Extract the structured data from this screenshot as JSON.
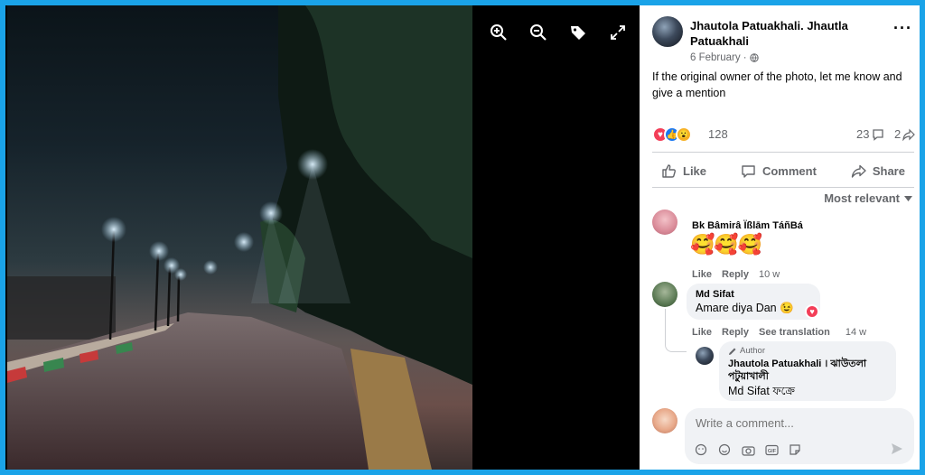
{
  "viewer": {
    "tools": [
      "zoom-in-icon",
      "zoom-out-icon",
      "tag-icon",
      "fullscreen-icon"
    ]
  },
  "post": {
    "page_name": "Jhautola Patuakhali. Jhautla Patuakhali",
    "date": "6 February ·",
    "privacy_icon": "globe-icon",
    "caption": "If the original owner of the photo, let me know and give a mention",
    "reaction_count": "128",
    "comment_count": "23",
    "share_count": "2"
  },
  "actions": {
    "like": "Like",
    "comment": "Comment",
    "share": "Share"
  },
  "sort": {
    "label": "Most relevant"
  },
  "comments": [
    {
      "name": "Bk Bâmirâ Ïßlām TáñBá",
      "text": "🥰🥰🥰",
      "like": "Like",
      "reply": "Reply",
      "time": "10 w"
    },
    {
      "name": "Md Sifat",
      "text": "Amare diya Dan 😉",
      "like": "Like",
      "reply": "Reply",
      "translate": "See translation",
      "time": "14 w"
    }
  ],
  "reply": {
    "badge": "Author",
    "name": "Jhautola Patuakhali । ঝাউতলা পটুয়াখালী",
    "text": "Md Sifat ফক্রে"
  },
  "composer": {
    "placeholder": "Write a comment..."
  },
  "colors": {
    "accent": "#1877f2",
    "frame": "#1aa3e8",
    "muted": "#65676b"
  }
}
